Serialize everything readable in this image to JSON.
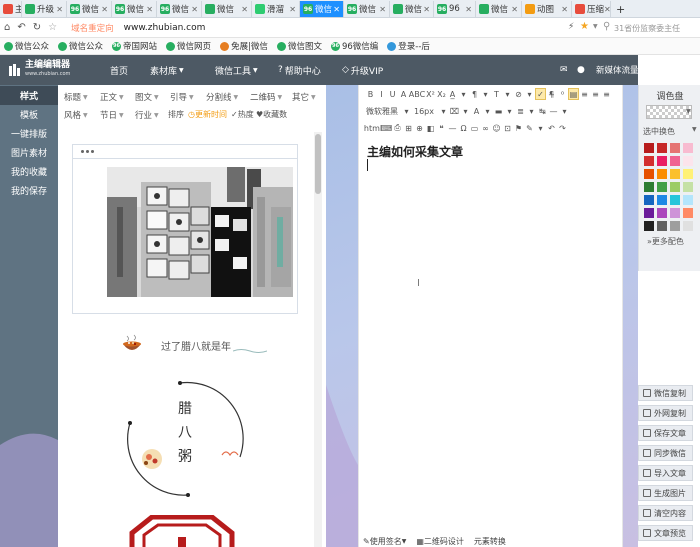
{
  "tabs": [
    {
      "label": "主步",
      "color": "#e74c3c",
      "icon": "page-icon"
    },
    {
      "label": "升级",
      "color": "#27ae60",
      "icon": "leaf-icon"
    },
    {
      "label": "微信",
      "color": "#27ae60",
      "icon": "96-icon",
      "badge": "96"
    },
    {
      "label": "微信",
      "color": "#27ae60",
      "icon": "96-icon",
      "badge": "96"
    },
    {
      "label": "微信",
      "color": "#27ae60",
      "icon": "96-icon",
      "badge": "96"
    },
    {
      "label": "微信",
      "color": "#27ae60",
      "icon": "leaf-icon"
    },
    {
      "label": "滑溜",
      "color": "#2ecc71",
      "icon": "wechat-icon"
    },
    {
      "label": "微信",
      "color": "#27ae60",
      "icon": "96-icon",
      "badge": "96"
    },
    {
      "label": "微信",
      "color": "#27ae60",
      "icon": "96-icon",
      "badge": "96"
    },
    {
      "label": "微信",
      "color": "#27ae60",
      "icon": "leaf-icon"
    },
    {
      "label": "96",
      "color": "#27ae60",
      "icon": "96-icon",
      "badge": "96"
    },
    {
      "label": "微信",
      "color": "#27ae60",
      "icon": "leaf-icon"
    },
    {
      "label": "动图",
      "color": "#f39c12",
      "icon": "q-icon"
    },
    {
      "label": "压缩",
      "color": "#e74c3c",
      "icon": "compress-icon"
    }
  ],
  "new_tab": "+",
  "address": {
    "prefix": "域名重定向",
    "url": "www.zhubian.com",
    "right_text": "31省份监察委主任"
  },
  "bookmarks": [
    {
      "label": "微信公众",
      "color": "#27ae60"
    },
    {
      "label": "微信公众",
      "color": "#27ae60"
    },
    {
      "label": "帝国网站",
      "color": "#27ae60",
      "badge": "96"
    },
    {
      "label": "微信网页",
      "color": "#27ae60"
    },
    {
      "label": "免展|微信",
      "color": "#e67e22"
    },
    {
      "label": "微信图文",
      "color": "#27ae60"
    },
    {
      "label": "96微信编",
      "color": "#27ae60",
      "badge": "96"
    },
    {
      "label": "登录--后",
      "color": "#3498db"
    }
  ],
  "app": {
    "logo": "主编编辑器",
    "logo_sub": "www.zhubian.com",
    "nav": [
      "首页",
      "素材库",
      "微信工具",
      "帮助中心",
      "升级VIP"
    ],
    "user": "新媒体流量资源合作社"
  },
  "left_nav": [
    "样式",
    "模板",
    "一键排版",
    "图片素材",
    "我的收藏",
    "我的保存"
  ],
  "categories_row1": [
    "标题",
    "正文",
    "图文",
    "引导",
    "分割线",
    "二维码",
    "其它"
  ],
  "categories_row2": [
    "风格",
    "节日",
    "行业",
    "排序"
  ],
  "sort_options": [
    "更新时间",
    "热度",
    "收藏数"
  ],
  "preview": {
    "card2_text": "过了腊八就是年",
    "card3_chars": [
      "腊",
      "八",
      "粥"
    ]
  },
  "editor": {
    "title": "主编如何采集文章",
    "font_label": "微软雅黑",
    "size_label": "16px",
    "bottom": [
      "使用签名",
      "二维码设计",
      "元素转换"
    ]
  },
  "color_panel": {
    "title": "调色盘",
    "selected_label": "选中换色",
    "more_label": "更多配色",
    "swatches": [
      "#b71c1c",
      "#c62828",
      "#e57373",
      "#f8bbd0",
      "#d32f2f",
      "#e91e63",
      "#f06292",
      "#fce4ec",
      "#e65100",
      "#fb8c00",
      "#fbc02d",
      "#fff176",
      "#2e7d32",
      "#43a047",
      "#9ccc65",
      "#c5e1a5",
      "#1565c0",
      "#1e88e5",
      "#26c6da",
      "#b3e5fc",
      "#6a1b9a",
      "#ab47bc",
      "#ce93d8",
      "#ff8a65",
      "#212121",
      "#616161",
      "#9e9e9e",
      "#e0e0e0"
    ]
  },
  "right_buttons": [
    "微信复制",
    "外网复制",
    "保存文章",
    "同步微信",
    "导入文章",
    "生成图片",
    "清空内容",
    "文章预览"
  ]
}
